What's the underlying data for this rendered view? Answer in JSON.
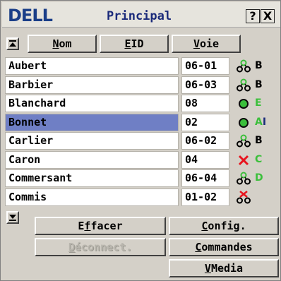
{
  "window": {
    "logo_text": "DELL",
    "title": "Principal",
    "help_label": "?",
    "close_label": "X"
  },
  "columns": {
    "name": {
      "accel": "N",
      "rest": "om"
    },
    "eid": {
      "accel": "E",
      "rest": "ID"
    },
    "port": {
      "accel": "V",
      "rest": "oie"
    }
  },
  "rows": [
    {
      "name": "Aubert",
      "eid": "06-01",
      "status_icon": "network-connected-icon",
      "status_letters": "B",
      "letters_color": "black"
    },
    {
      "name": "Barbier",
      "eid": "06-03",
      "status_icon": "network-connected-icon",
      "status_letters": "B",
      "letters_color": "black"
    },
    {
      "name": "Blanchard",
      "eid": "08",
      "status_icon": "online-circle-icon",
      "status_letters": "E",
      "letters_color": "green"
    },
    {
      "name": "Bonnet",
      "eid": "02",
      "status_icon": "online-circle-icon",
      "status_letters": "AI",
      "letters_color": "mixed",
      "selected": true
    },
    {
      "name": "Carlier",
      "eid": "06-02",
      "status_icon": "network-connected-icon",
      "status_letters": "B",
      "letters_color": "black"
    },
    {
      "name": "Caron",
      "eid": "04",
      "status_icon": "offline-x-icon",
      "status_letters": "C",
      "letters_color": "green"
    },
    {
      "name": "Commersant",
      "eid": "06-04",
      "status_icon": "network-connected-icon",
      "status_letters": "D",
      "letters_color": "green"
    },
    {
      "name": "Commis",
      "eid": "01-02",
      "status_icon": "network-offline-icon",
      "status_letters": "",
      "letters_color": "black"
    }
  ],
  "buttons": {
    "clear": {
      "accel": "f",
      "pre": "E",
      "post": "facer"
    },
    "config": {
      "accel": "C",
      "pre": "",
      "post": "onfig."
    },
    "disconnect": {
      "accel": "D",
      "pre": "",
      "post": "éconnect."
    },
    "commands": {
      "accel": "C",
      "pre": "",
      "post": "ommandes"
    },
    "vmedia": {
      "accel": "V",
      "pre": "",
      "post": "Media"
    }
  },
  "colors": {
    "selection": "#6f7fc5",
    "online_green": "#3bbf3b",
    "offline_red": "#e8141e",
    "title_blue": "#1a2a7a"
  }
}
